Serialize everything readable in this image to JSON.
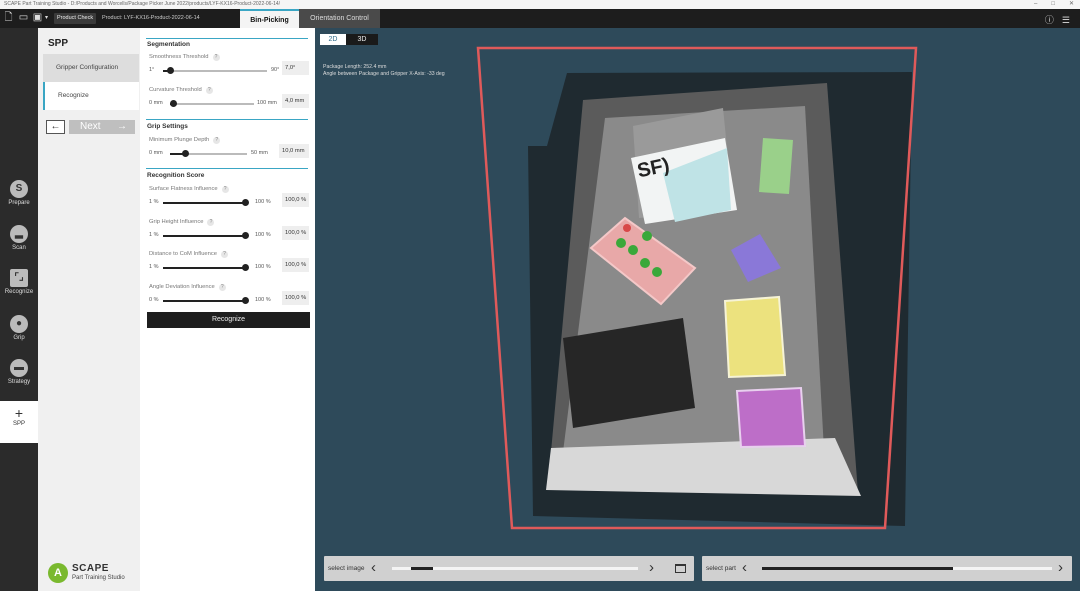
{
  "window": {
    "title": "SCAPE Part Training Studio - D:/Products and Worcells/Package Picker June 2022/products/LYF-KX16-Product-2022-06-14/"
  },
  "topbar": {
    "product_check_label": "Product Check",
    "product_path": "Product: LYF-KX16-Product-2022-06-14",
    "tabs": [
      {
        "label": "Bin-Picking",
        "active": true
      },
      {
        "label": "Orientation Control",
        "active": false
      }
    ]
  },
  "left_nav": {
    "items": [
      {
        "label": "Prepare",
        "icon": "prepare-icon"
      },
      {
        "label": "Scan",
        "icon": "scan-icon"
      },
      {
        "label": "Recognize",
        "icon": "recognize-icon"
      },
      {
        "label": "Grip",
        "icon": "grip-icon"
      },
      {
        "label": "Strategy",
        "icon": "strategy-icon"
      },
      {
        "label": "SPP",
        "icon": "plus-icon",
        "active": true
      }
    ]
  },
  "spp_panel": {
    "title": "SPP",
    "gripper_config": "Gripper Configuration",
    "recognize": "Recognize",
    "back_label": "←",
    "next_label": "Next",
    "next_arrow": "→"
  },
  "logo": {
    "name": "SCAPE",
    "subtitle": "Part Training Studio"
  },
  "settings": {
    "segmentation": {
      "title": "Segmentation",
      "smoothness": {
        "label": "Smoothness Threshold",
        "min": "1°",
        "max": "90°",
        "value": "7,0°",
        "fraction": 0.07
      },
      "curvature": {
        "label": "Curvature Threshold",
        "min": "0 mm",
        "max": "100 mm",
        "value": "4,0 mm",
        "fraction": 0.04
      }
    },
    "grip": {
      "title": "Grip Settings",
      "plunge": {
        "label": "Minimum Plunge Depth",
        "min": "0 mm",
        "max": "50 mm",
        "value": "10,0 mm",
        "fraction": 0.2
      }
    },
    "recognition": {
      "title": "Recognition Score",
      "flatness": {
        "label": "Surface Flatness Influence",
        "min": "1 %",
        "max": "100 %",
        "value": "100,0 %",
        "fraction": 1.0
      },
      "height": {
        "label": "Grip Height Influence",
        "min": "1 %",
        "max": "100 %",
        "value": "100,0 %",
        "fraction": 1.0
      },
      "com": {
        "label": "Distance to CoM Influence",
        "min": "1 %",
        "max": "100 %",
        "value": "100,0 %",
        "fraction": 1.0
      },
      "angle": {
        "label": "Angle Deviation Influence",
        "min": "0 %",
        "max": "100 %",
        "value": "100,0 %",
        "fraction": 1.0
      }
    },
    "button_label": "Recognize"
  },
  "viewport": {
    "tab_2d": "2D",
    "tab_3d": "3D",
    "info_line1": "Package Length: 252.4 mm",
    "info_line2": "Angle between Package and Gripper X-Axis: -33 deg",
    "select_image": "select image",
    "select_part": "select part",
    "image_slider_fraction": 0.12,
    "part_slider_fraction": 0.66
  },
  "colors": {
    "accent": "#3aa6c4",
    "viewport_bg": "#2e4a5a",
    "bin_outline": "#e05a5a",
    "logo_green": "#7ab92e"
  }
}
